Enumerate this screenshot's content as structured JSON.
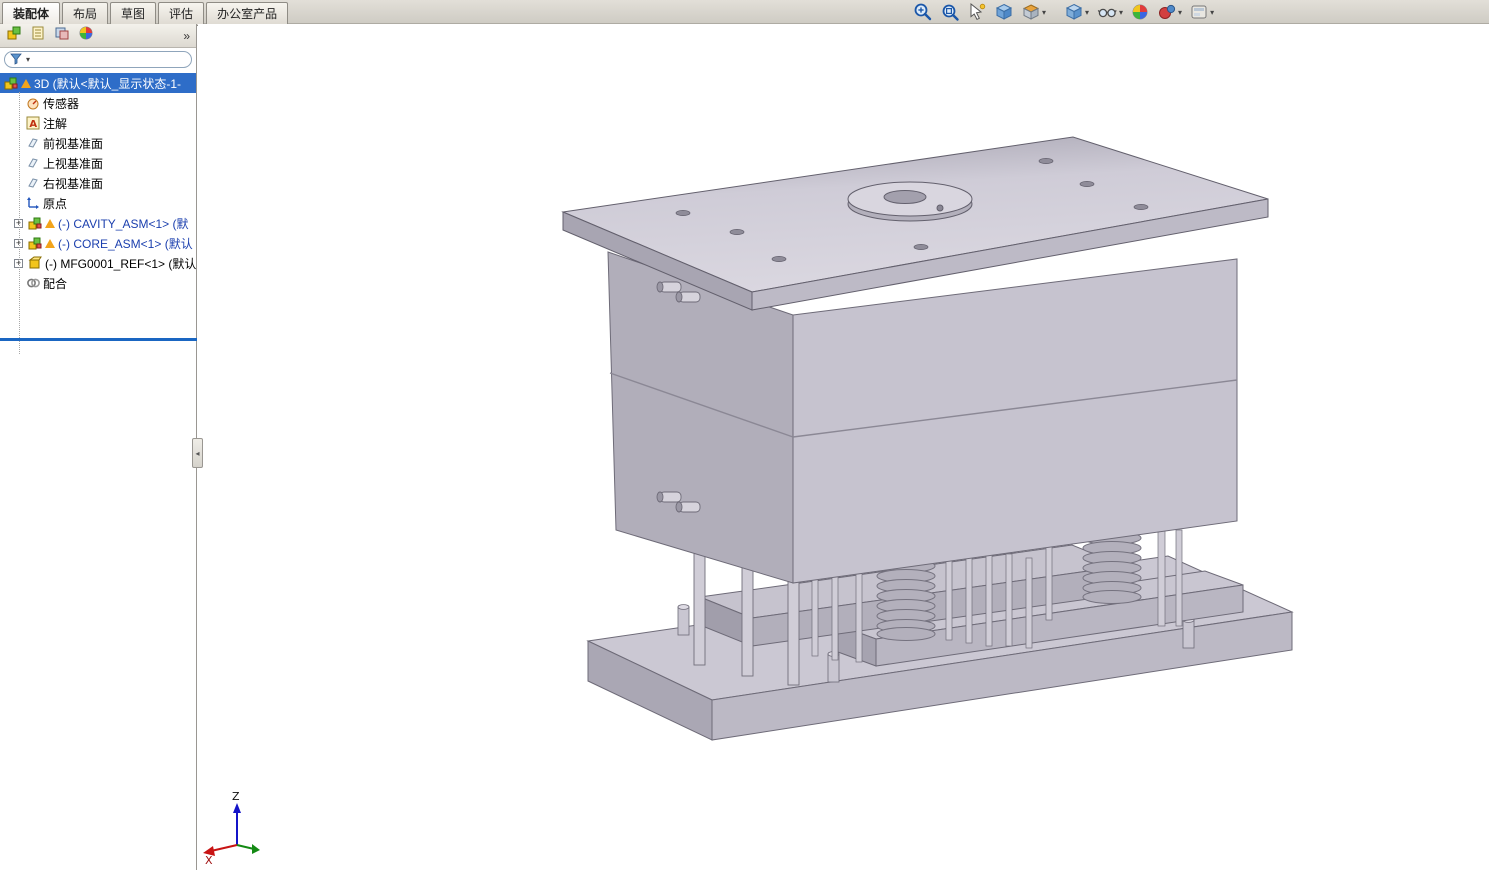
{
  "ui": {
    "caret": "▾",
    "plus": "+",
    "more": "»",
    "splitter_arrow": "◂"
  },
  "colors": {
    "selection_blue": "#2e6dc8",
    "pane_split_blue": "#1a66c2",
    "model_gray": "#c6c3cf",
    "warning_orange": "#f2a41c"
  },
  "command_tabs": [
    {
      "label": "装配体",
      "active": true
    },
    {
      "label": "布局",
      "active": false
    },
    {
      "label": "草图",
      "active": false
    },
    {
      "label": "评估",
      "active": false
    },
    {
      "label": "办公室产品",
      "active": false
    }
  ],
  "view_toolbar": {
    "icons": [
      "zoom-in",
      "zoom-fit",
      "filter-pointer",
      "orientation-cube",
      "section-view",
      "view-cube",
      "hide-show-items",
      "edit-appearance",
      "apply-scene",
      "view-settings"
    ]
  },
  "feature_tree": {
    "root": {
      "label": "3D  (默认<默认_显示状态-1-"
    },
    "items": [
      {
        "label": "传感器"
      },
      {
        "label": "注解"
      },
      {
        "label": "前视基准面"
      },
      {
        "label": "上视基准面"
      },
      {
        "label": "右视基准面"
      },
      {
        "label": "原点"
      },
      {
        "label": "(-) CAVITY_ASM<1> (默"
      },
      {
        "label": "(-) CORE_ASM<1> (默认"
      },
      {
        "label": "(-) MFG0001_REF<1> (默认"
      },
      {
        "label": "配合"
      }
    ]
  },
  "triad": {
    "z_label": "Z",
    "x_label": "X"
  }
}
